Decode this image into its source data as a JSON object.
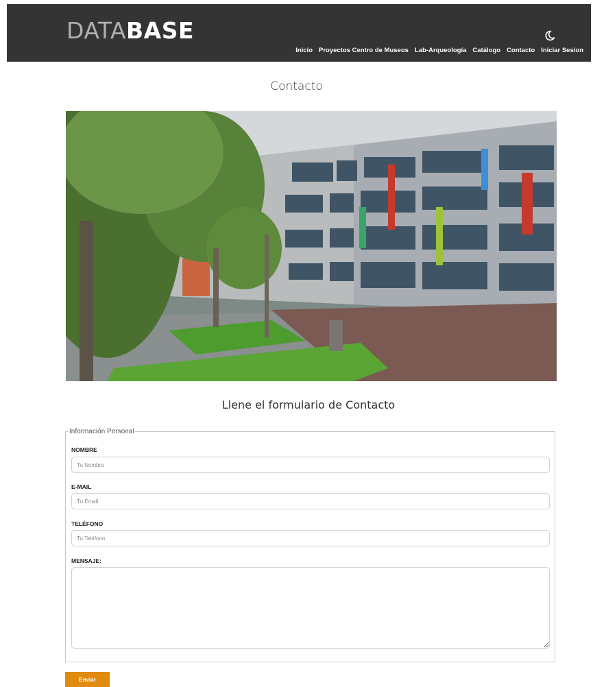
{
  "header": {
    "logo_light": "DATA",
    "logo_bold": "BASE",
    "theme_toggle_icon": "moon-icon",
    "nav": [
      "Inicio",
      "Proyectos Centro de Museos",
      "Lab-Arqueología",
      "Catálogo",
      "Contacto",
      "Iniciar Sesion"
    ]
  },
  "page": {
    "title": "Contacto",
    "hero_image": "campus-building-photo",
    "form_title": "Llene el formulario de Contacto"
  },
  "form": {
    "legend": "Información Personal",
    "name_label": "NOMBRE",
    "name_placeholder": "Tu Nombre",
    "email_label": "E-MAIL",
    "email_placeholder": "Tu Email",
    "phone_label": "TELÉFONO",
    "phone_placeholder": "Tu Teléfono",
    "message_label": "MENSAJE:",
    "submit_label": "Enviar"
  },
  "colors": {
    "header_bg": "#343434",
    "submit_bg": "#e08b0f"
  }
}
